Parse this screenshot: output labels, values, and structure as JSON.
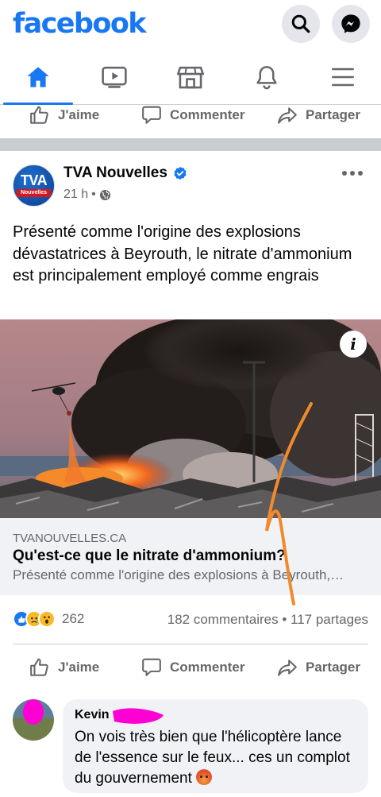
{
  "app": {
    "logo": "facebook"
  },
  "header": {
    "search_icon": "search-icon",
    "messenger_icon": "messenger-icon"
  },
  "nav": {
    "tabs": [
      "home",
      "watch",
      "marketplace",
      "notifications",
      "menu"
    ],
    "active": "home",
    "accent": "#1877f2"
  },
  "actions": {
    "like": "J'aime",
    "comment": "Commenter",
    "share": "Partager"
  },
  "post": {
    "page_name": "TVA Nouvelles",
    "verified": true,
    "avatar_text": "TVA",
    "avatar_subtext": "Nouvelles",
    "time": "21 h",
    "audience_icon": "globe-icon",
    "text": "Présenté comme l'origine des explosions dévastatrices à Beyrouth, le nitrate d'ammonium est principalement employé comme engrais",
    "link": {
      "domain": "TVANOUVELLES.CA",
      "title": "Qu'est-ce que le nitrate d'ammonium?",
      "description": "Présenté comme l'origine des explosions à Beyrouth,…"
    },
    "image_info": "i",
    "reactions": {
      "types": [
        "like",
        "sad",
        "wow"
      ],
      "count": "262"
    },
    "stats": "182 commentaires • 117 partages"
  },
  "comment": {
    "author": "Kevin",
    "text": "On vois très bien que l'hélicoptère lance de l'essence sur le feux... ces un complot du gouvernement",
    "emoji": "angry-emoji"
  },
  "colors": {
    "brand": "#1877f2",
    "secondary_text": "#65676b",
    "scribble_orange": "#f08a2c",
    "scribble_magenta": "#ff00d4"
  }
}
